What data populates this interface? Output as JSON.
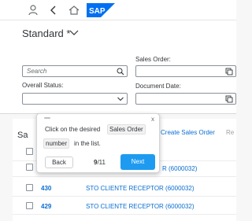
{
  "shell": {
    "logo_text": "SAP",
    "icons": [
      "user-icon",
      "back-icon",
      "home-icon"
    ]
  },
  "header": {
    "variant_title": "Standard *",
    "filters": {
      "search_placeholder": "Search",
      "sales_order_label": "Sales Order:",
      "overall_status_label": "Overall Status:",
      "document_date_label": "Document Date:"
    }
  },
  "table": {
    "title_partial": "Sa",
    "toolbar_create": "Create Sales Order",
    "toolbar_more": "Re",
    "rows": [
      {
        "number": "",
        "customer": "R (6000032)"
      },
      {
        "number": "430",
        "customer": "STO CLIENTE RECEPTOR (6000032)"
      },
      {
        "number": "429",
        "customer": "STO CLIENTE RECEPTOR (6000032)"
      }
    ]
  },
  "popover": {
    "text_before": "Click on the desired",
    "chip_line1": "Sales Order",
    "chip_line2": "number",
    "text_after": "in the list.",
    "back_label": "Back",
    "step_current": "9",
    "step_total": "/11",
    "next_label": "Next",
    "close_glyph": "x"
  },
  "colors": {
    "accent": "#0a6ed1",
    "next_button": "#1e9bf0",
    "sap_blue": "#0070f2"
  }
}
